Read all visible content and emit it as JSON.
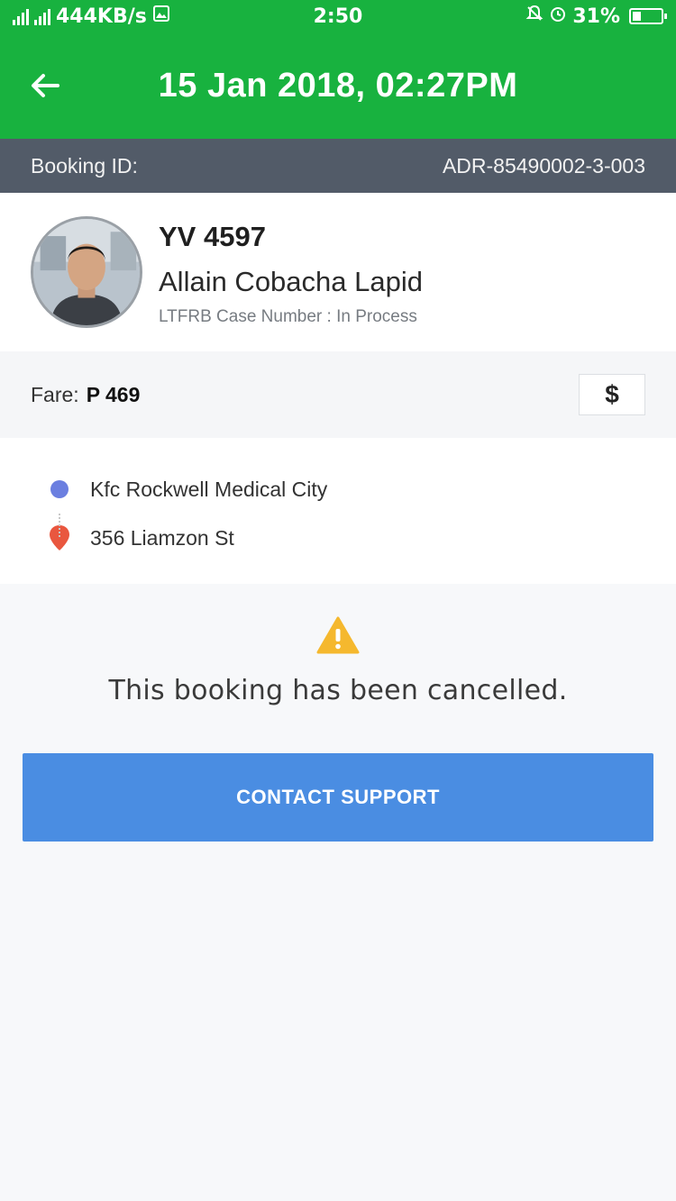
{
  "status_bar": {
    "network_speed": "444KB/s",
    "time": "2:50",
    "battery_percent": "31%",
    "battery_level": 0.31
  },
  "header": {
    "back_icon": "arrow-left-icon",
    "title": "15 Jan 2018, 02:27PM",
    "background": "#18b23f"
  },
  "booking": {
    "label": "Booking ID:",
    "id": "ADR-85490002-3-003"
  },
  "driver": {
    "plate": "YV 4597",
    "name": "Allain Cobacha Lapid",
    "case_number": "LTFRB Case Number : In Process"
  },
  "fare": {
    "label": "Fare:",
    "value": "P 469",
    "payment_icon_glyph": "$"
  },
  "route": {
    "pickup": "Kfc Rockwell Medical City",
    "dropoff": "356 Liamzon St"
  },
  "notice": {
    "icon": "warning-icon",
    "message": "This booking has been cancelled."
  },
  "actions": {
    "contact_support": "CONTACT SUPPORT",
    "button_color": "#4a8de2"
  }
}
